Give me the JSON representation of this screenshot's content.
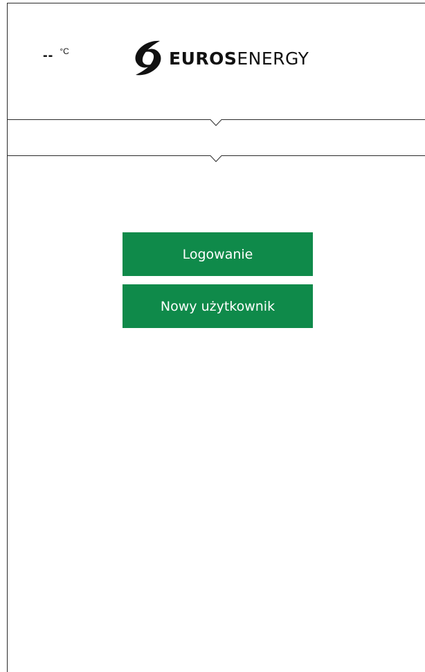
{
  "header": {
    "temperature_value": "--",
    "temperature_unit": "°C",
    "logo": {
      "brand_bold": "EUROS",
      "brand_light": "ENERGY"
    }
  },
  "main": {
    "login_button": "Logowanie",
    "new_user_button": "Nowy użytkownik"
  },
  "colors": {
    "primary_button": "#0f8a4a",
    "button_text": "#ffffff",
    "frame_line": "#2a2a2a"
  },
  "icons": {
    "logo_mark": "euros-energy-swirl-icon",
    "dropdown_indicators": [
      "chevron-down-icon",
      "chevron-down-icon"
    ]
  }
}
